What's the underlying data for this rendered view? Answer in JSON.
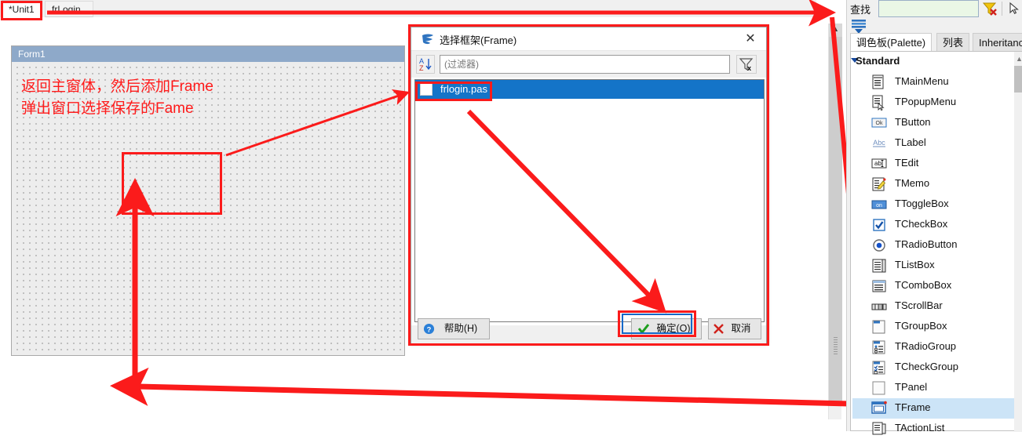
{
  "editor": {
    "tabs": [
      {
        "label": "*Unit1",
        "active": true
      },
      {
        "label": "frLogin",
        "active": false
      }
    ]
  },
  "designer": {
    "form_caption": "Form1",
    "notes": [
      "返回主窗体，然后添加Frame",
      "弹出窗口选择保存的Fame"
    ]
  },
  "dialog": {
    "title": "选择框架(Frame)",
    "icon": "lazarus-swirl-icon",
    "close_label": "✕",
    "sort_icon": "sort-az-icon",
    "filter_placeholder": "(过滤器)",
    "filter_value": "",
    "clear_filter_icon": "clear-filter-icon",
    "items": [
      {
        "label": "frlogin.pas",
        "selected": true
      }
    ],
    "buttons": {
      "help": "帮助(H)",
      "ok": "确定(O)",
      "cancel": "取消"
    }
  },
  "palette": {
    "find_label": "查找",
    "find_value": "",
    "find_clear_icon": "clear-filter-icon",
    "cursor_icon": "select-cursor-icon",
    "tree_icon": "component-tree-icon",
    "collapse_icon": "collapse-all-icon",
    "tabs": [
      {
        "label": "调色板(Palette)",
        "active": true
      },
      {
        "label": "列表",
        "active": false
      },
      {
        "label": "Inheritance",
        "active": false
      }
    ],
    "group": "Standard",
    "components": [
      {
        "label": "TMainMenu",
        "icon": "main-menu-icon",
        "selected": false
      },
      {
        "label": "TPopupMenu",
        "icon": "popup-menu-icon",
        "selected": false
      },
      {
        "label": "TButton",
        "icon": "button-icon",
        "selected": false
      },
      {
        "label": "TLabel",
        "icon": "label-icon",
        "selected": false
      },
      {
        "label": "TEdit",
        "icon": "edit-icon",
        "selected": false
      },
      {
        "label": "TMemo",
        "icon": "memo-icon",
        "selected": false
      },
      {
        "label": "TToggleBox",
        "icon": "togglebox-icon",
        "selected": false
      },
      {
        "label": "TCheckBox",
        "icon": "checkbox-icon",
        "selected": false
      },
      {
        "label": "TRadioButton",
        "icon": "radiobutton-icon",
        "selected": false
      },
      {
        "label": "TListBox",
        "icon": "listbox-icon",
        "selected": false
      },
      {
        "label": "TComboBox",
        "icon": "combobox-icon",
        "selected": false
      },
      {
        "label": "TScrollBar",
        "icon": "scrollbar-icon",
        "selected": false
      },
      {
        "label": "TGroupBox",
        "icon": "groupbox-icon",
        "selected": false
      },
      {
        "label": "TRadioGroup",
        "icon": "radiogroup-icon",
        "selected": false
      },
      {
        "label": "TCheckGroup",
        "icon": "checkgroup-icon",
        "selected": false
      },
      {
        "label": "TPanel",
        "icon": "panel-icon",
        "selected": false
      },
      {
        "label": "TFrame",
        "icon": "frame-icon",
        "selected": true
      },
      {
        "label": "TActionList",
        "icon": "actionlist-icon",
        "selected": false
      }
    ]
  },
  "annotation": {
    "color": "#fb1b1b"
  }
}
